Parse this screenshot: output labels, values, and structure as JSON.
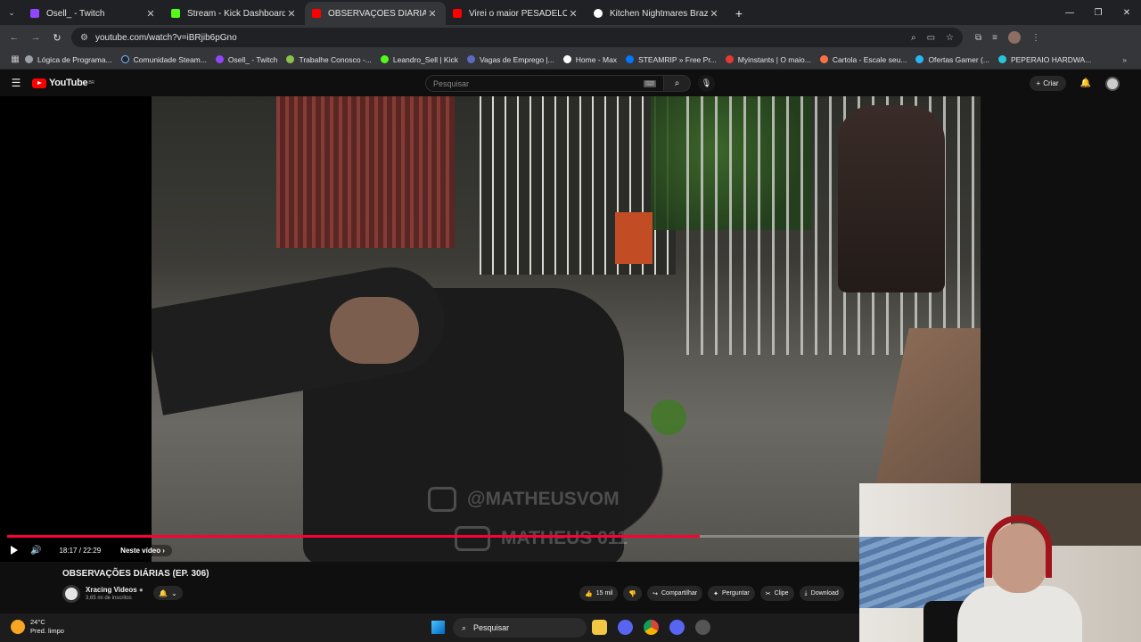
{
  "browser": {
    "tabs": [
      {
        "title": "Osell_ - Twitch",
        "color": "#9146ff",
        "active": false
      },
      {
        "title": "Stream - Kick Dashboard",
        "color": "#53fc18",
        "active": false
      },
      {
        "title": "OBSERVAÇÕES DIÁRIAS (EP. 30",
        "color": "#ff0000",
        "active": true
      },
      {
        "title": "Virei o maior PESADELO dos pi",
        "color": "#ff0000",
        "active": false
      },
      {
        "title": "Kitchen Nightmares Brazil • HB",
        "color": "#ffffff",
        "active": false
      }
    ],
    "url": "youtube.com/watch?v=iBRjib6pGno"
  },
  "bookmarks": [
    {
      "label": "Lógica de Programa...",
      "color": "#9aa0a6"
    },
    {
      "label": "Comunidade Steam...",
      "color": "#1b2838"
    },
    {
      "label": "Osell_ - Twitch",
      "color": "#9146ff"
    },
    {
      "label": "Trabalhe Conosco -...",
      "color": "#8bc34a"
    },
    {
      "label": "Leandro_Sell | Kick",
      "color": "#53fc18"
    },
    {
      "label": "Vagas de Emprego |...",
      "color": "#5c6bc0"
    },
    {
      "label": "Home - Max",
      "color": "#ffffff"
    },
    {
      "label": "STEAMRIP » Free Pr...",
      "color": "#0077ff"
    },
    {
      "label": "Myinstants | O maio...",
      "color": "#e53935"
    },
    {
      "label": "Cartola - Escale seu...",
      "color": "#ff7043"
    },
    {
      "label": "Ofertas Gamer (...",
      "color": "#29b6f6"
    },
    {
      "label": "PEPERAIO HARDWA...",
      "color": "#26c6da"
    }
  ],
  "youtube": {
    "logo_text": "YouTube",
    "region": "BR",
    "search_placeholder": "Pesquisar",
    "create_label": "Criar",
    "watermark_line1": "@MATHEUSVOM",
    "watermark_line2": "MATHEUS 011",
    "player": {
      "time": "18:17 / 22:29",
      "chapter": "Neste vídeo",
      "progress": 0.813
    },
    "video_title": "OBSERVAÇÕES DIÁRIAS (EP. 306)",
    "channel_name": "Xracing Videos",
    "channel_subs": "3,65 mi de inscritos",
    "actions": {
      "likes": "15 mil",
      "share": "Compartilhar",
      "ask": "Perguntar",
      "clip": "Clipe",
      "download": "Download"
    }
  },
  "taskbar": {
    "temp": "24°C",
    "weather": "Pred. limpo",
    "search": "Pesquisar"
  }
}
